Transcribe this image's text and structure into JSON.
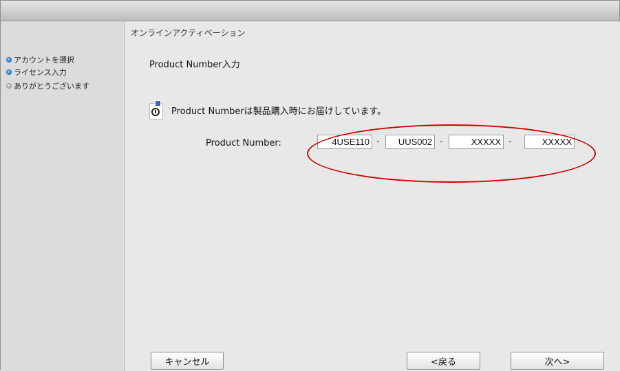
{
  "window": {
    "title": ""
  },
  "sidebar": {
    "steps": [
      {
        "label": "アカウントを選択",
        "state": "done"
      },
      {
        "label": "ライセンス入力",
        "state": "current"
      },
      {
        "label": "ありがとうございます",
        "state": "pending"
      }
    ]
  },
  "main": {
    "header": "オンラインアクティベーション",
    "section_title": "Product Number入力",
    "info_text": "Product Numberは製品購入時にお届けしています。",
    "product_number": {
      "label": "Product Number:",
      "fields": [
        "4USE110",
        "UUS002",
        "XXXXX",
        "XXXXX"
      ],
      "separator": "-"
    }
  },
  "buttons": {
    "cancel": "キャンセル",
    "back": "<戻る",
    "next": "次へ>"
  },
  "colors": {
    "highlight_ellipse": "#d50000",
    "active_step_dot": "#1b7fd6"
  }
}
